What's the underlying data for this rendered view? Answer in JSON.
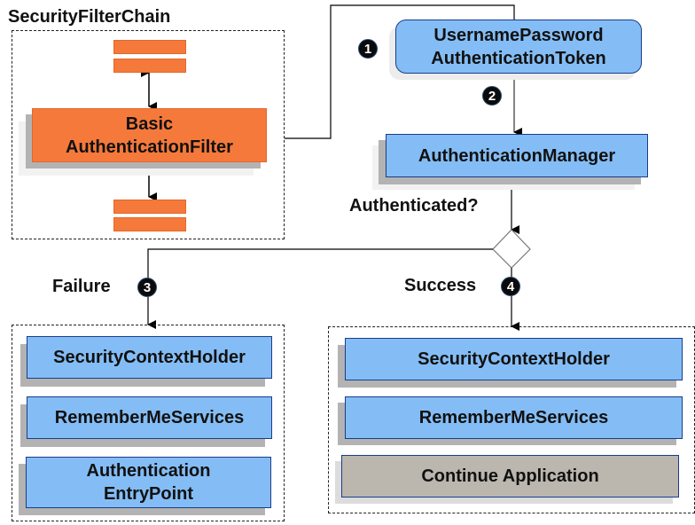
{
  "title": "SecurityFilterChain",
  "filter_chain": {
    "main_filter": "Basic\nAuthenticationFilter"
  },
  "nodes": {
    "token": [
      "UsernamePassword",
      "AuthenticationToken"
    ],
    "manager": "AuthenticationManager",
    "decision_label": "Authenticated?"
  },
  "steps": [
    "1",
    "2",
    "3",
    "4"
  ],
  "failure": {
    "label": "Failure",
    "items": [
      "SecurityContextHolder",
      "RememberMeServices",
      "Authentication",
      "EntryPoint"
    ]
  },
  "success": {
    "label": "Success",
    "items": [
      "SecurityContextHolder",
      "RememberMeServices",
      "Continue Application"
    ]
  },
  "colors": {
    "filter": "#f5793b",
    "component": "#84bdf5",
    "continue": "#bbb7ae"
  }
}
